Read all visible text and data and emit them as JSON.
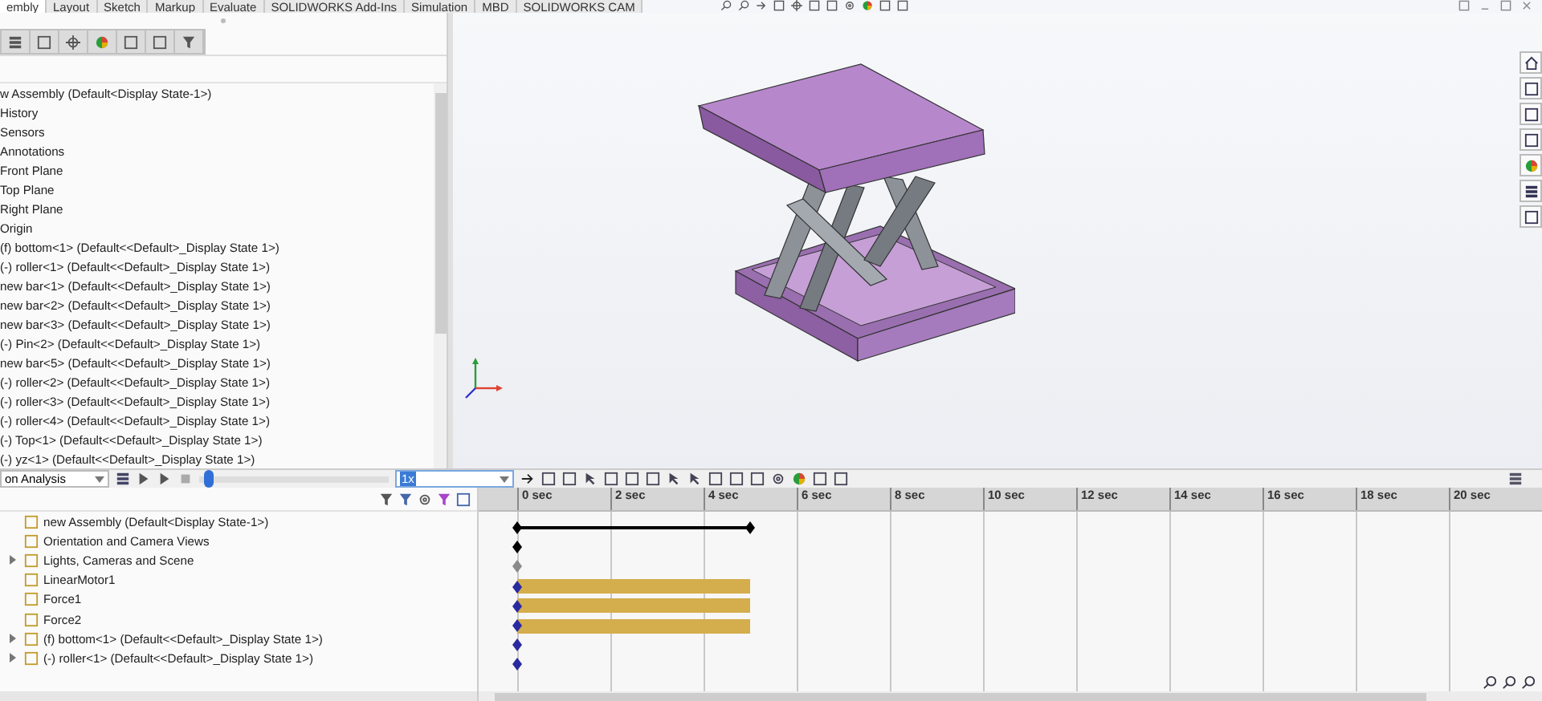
{
  "ribbon_tabs": [
    {
      "label": "embly",
      "selected": true
    },
    {
      "label": "Layout",
      "selected": false
    },
    {
      "label": "Sketch",
      "selected": false
    },
    {
      "label": "Markup",
      "selected": false
    },
    {
      "label": "Evaluate",
      "selected": false
    },
    {
      "label": "SOLIDWORKS Add-Ins",
      "selected": false
    },
    {
      "label": "Simulation",
      "selected": false
    },
    {
      "label": "MBD",
      "selected": false
    },
    {
      "label": "SOLIDWORKS CAM",
      "selected": false
    }
  ],
  "feature_tree": {
    "items": [
      {
        "label": "w Assembly  (Default<Display State-1>)"
      },
      {
        "label": "History"
      },
      {
        "label": "Sensors"
      },
      {
        "label": "Annotations"
      },
      {
        "label": "Front Plane"
      },
      {
        "label": "Top Plane"
      },
      {
        "label": "Right Plane"
      },
      {
        "label": "Origin"
      },
      {
        "label": "(f) bottom<1> (Default<<Default>_Display State 1>)"
      },
      {
        "label": "(-) roller<1> (Default<<Default>_Display State 1>)"
      },
      {
        "label": "new bar<1> (Default<<Default>_Display State 1>)"
      },
      {
        "label": "new bar<2> (Default<<Default>_Display State 1>)"
      },
      {
        "label": "new bar<3> (Default<<Default>_Display State 1>)"
      },
      {
        "label": "(-) Pin<2> (Default<<Default>_Display State 1>)"
      },
      {
        "label": "new bar<5> (Default<<Default>_Display State 1>)"
      },
      {
        "label": "(-) roller<2> (Default<<Default>_Display State 1>)"
      },
      {
        "label": "(-) roller<3> (Default<<Default>_Display State 1>)"
      },
      {
        "label": "(-) roller<4> (Default<<Default>_Display State 1>)"
      },
      {
        "label": "(-) Top<1> (Default<<Default>_Display State 1>)"
      },
      {
        "label": "(-) yz<1> (Default<<Default>_Display State 1>)"
      }
    ]
  },
  "motion_toolbar": {
    "study_type": "on Analysis",
    "speed": "1x",
    "timeline_slider": {
      "level": 0.03
    }
  },
  "motion_tree": {
    "items": [
      {
        "label": "new Assembly  (Default<Display State-1>)",
        "expandable": false
      },
      {
        "label": "Orientation and Camera Views",
        "expandable": false
      },
      {
        "label": "Lights, Cameras and Scene",
        "expandable": true
      },
      {
        "label": "LinearMotor1",
        "expandable": false
      },
      {
        "label": "Force1",
        "expandable": false
      },
      {
        "label": "Force2",
        "expandable": false
      },
      {
        "label": "(f) bottom<1> (Default<<Default>_Display State 1>)",
        "expandable": true
      },
      {
        "label": "(-) roller<1> (Default<<Default>_Display State 1>)",
        "expandable": true
      }
    ]
  },
  "timeline": {
    "ruler": [
      "0 sec",
      "2 sec",
      "4 sec",
      "6 sec",
      "8 sec",
      "10 sec",
      "12 sec",
      "14 sec",
      "16 sec",
      "18 sec",
      "20 sec"
    ],
    "rows": [
      {
        "kind": "span",
        "color": "#000000",
        "level": 0.227
      },
      {
        "kind": "key",
        "color": "#000000"
      },
      {
        "kind": "key",
        "color": "#8a8a8a"
      },
      {
        "kind": "bar",
        "color": "#2a2aa0",
        "level": 0.227
      },
      {
        "kind": "bar",
        "color": "#2a2aa0",
        "level": 0.227
      },
      {
        "kind": "bar",
        "color": "#2a2aa0",
        "level": 0.227
      },
      {
        "kind": "key",
        "color": "#2a2aa0"
      },
      {
        "kind": "key",
        "color": "#2a2aa0"
      }
    ]
  }
}
